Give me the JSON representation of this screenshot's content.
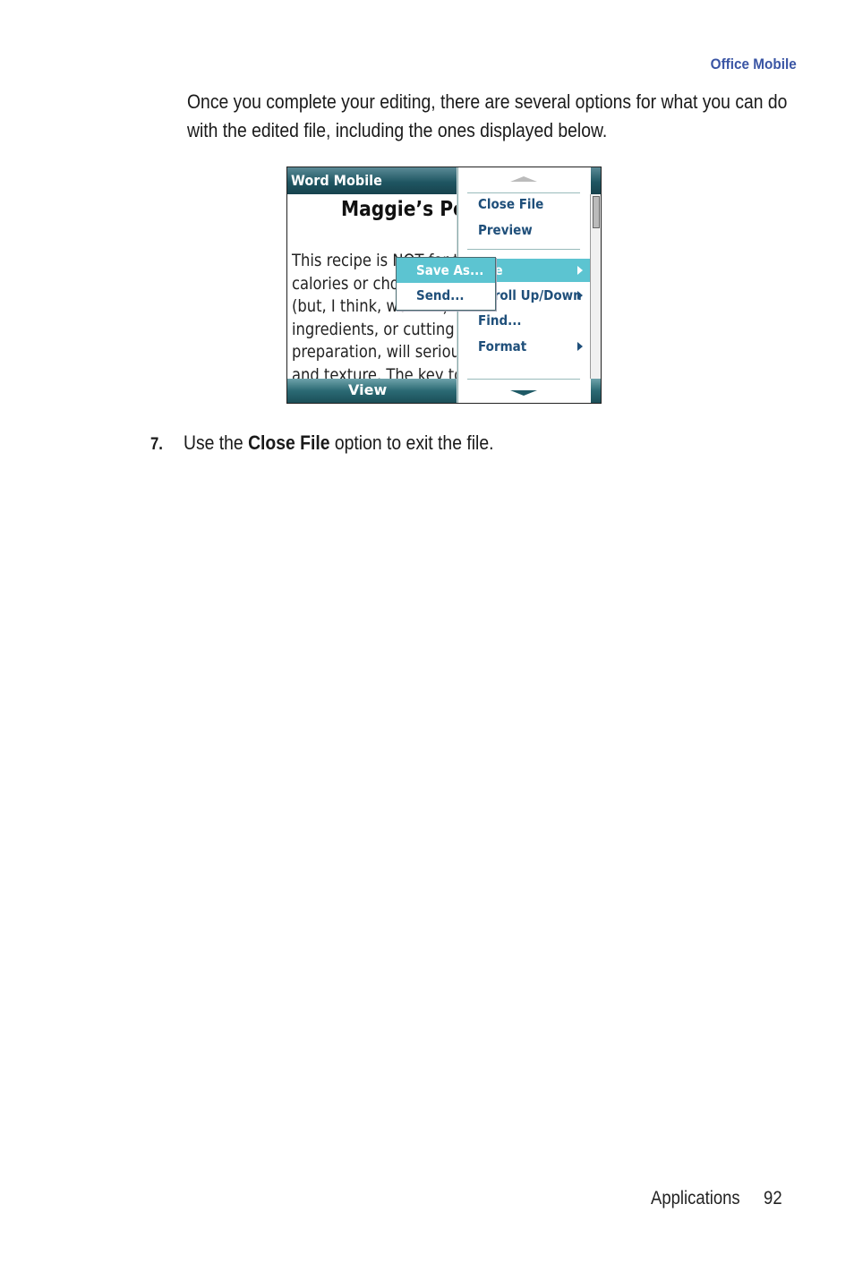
{
  "header": {
    "section": "Office Mobile"
  },
  "intro": "Once you complete your editing, there are several options for what you can do with the edited file, including the ones displayed below.",
  "screenshot": {
    "app_title": "Word Mobile",
    "doc_heading": "Maggie’s Po",
    "doc_lines": [
      "This recipe is NOT for the",
      "calories or cho",
      "(but, I think, worth it).",
      "ingredients, or cutting c",
      "preparation, will serious",
      "and texture. The key to"
    ],
    "softkey_left": "View",
    "menu": {
      "items": [
        {
          "label": "Close File",
          "submenu": false
        },
        {
          "label": "Preview",
          "submenu": false
        },
        {
          "label": "File",
          "submenu": true,
          "selected": true
        },
        {
          "label": "Scroll Up/Down",
          "submenu": true
        },
        {
          "label": "Find...",
          "submenu": false
        },
        {
          "label": "Format",
          "submenu": true
        }
      ],
      "submenu": [
        {
          "label": "Save As...",
          "selected": true
        },
        {
          "label": "Send..."
        }
      ]
    }
  },
  "step": {
    "number": "7.",
    "pre": "Use the ",
    "bold": "Close File",
    "post": " option to exit the file."
  },
  "footer": {
    "section": "Applications",
    "page": "92"
  }
}
